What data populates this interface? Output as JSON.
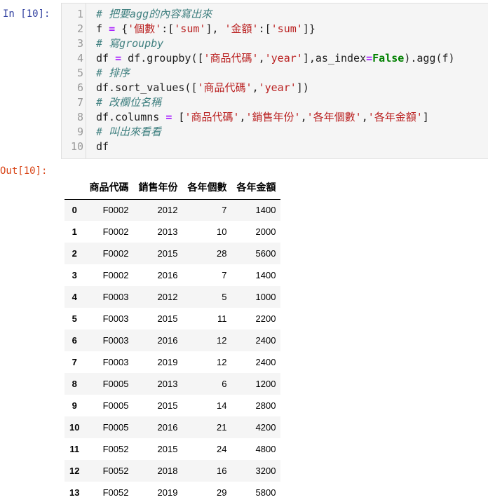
{
  "prompts": {
    "input": "In [10]:",
    "output": "Out[10]:"
  },
  "code_lines": [
    {
      "n": "1",
      "parts": [
        {
          "t": "# 把要agg的內容寫出來",
          "c": "cm"
        }
      ]
    },
    {
      "n": "2",
      "parts": [
        {
          "t": "f ",
          "c": ""
        },
        {
          "t": "=",
          "c": "op"
        },
        {
          "t": " {",
          "c": ""
        },
        {
          "t": "'個數'",
          "c": "str"
        },
        {
          "t": ":[",
          "c": ""
        },
        {
          "t": "'sum'",
          "c": "str"
        },
        {
          "t": "], ",
          "c": ""
        },
        {
          "t": "'金額'",
          "c": "str"
        },
        {
          "t": ":[",
          "c": ""
        },
        {
          "t": "'sum'",
          "c": "str"
        },
        {
          "t": "]}",
          "c": ""
        }
      ]
    },
    {
      "n": "3",
      "parts": [
        {
          "t": "# 寫groupby",
          "c": "cm"
        }
      ]
    },
    {
      "n": "4",
      "parts": [
        {
          "t": "df ",
          "c": ""
        },
        {
          "t": "=",
          "c": "op"
        },
        {
          "t": " df.groupby([",
          "c": ""
        },
        {
          "t": "'商品代碼'",
          "c": "str"
        },
        {
          "t": ",",
          "c": ""
        },
        {
          "t": "'year'",
          "c": "str"
        },
        {
          "t": "],as_index",
          "c": ""
        },
        {
          "t": "=",
          "c": "op"
        },
        {
          "t": "False",
          "c": "kw"
        },
        {
          "t": ").agg(f)",
          "c": ""
        }
      ]
    },
    {
      "n": "5",
      "parts": [
        {
          "t": "# 排序",
          "c": "cm"
        }
      ]
    },
    {
      "n": "6",
      "parts": [
        {
          "t": "df.sort_values([",
          "c": ""
        },
        {
          "t": "'商品代碼'",
          "c": "str"
        },
        {
          "t": ",",
          "c": ""
        },
        {
          "t": "'year'",
          "c": "str"
        },
        {
          "t": "])",
          "c": ""
        }
      ]
    },
    {
      "n": "7",
      "parts": [
        {
          "t": "# 改欄位名稱",
          "c": "cm"
        }
      ]
    },
    {
      "n": "8",
      "parts": [
        {
          "t": "df.columns ",
          "c": ""
        },
        {
          "t": "=",
          "c": "op"
        },
        {
          "t": " [",
          "c": ""
        },
        {
          "t": "'商品代碼'",
          "c": "str"
        },
        {
          "t": ",",
          "c": ""
        },
        {
          "t": "'銷售年份'",
          "c": "str"
        },
        {
          "t": ",",
          "c": ""
        },
        {
          "t": "'各年個數'",
          "c": "str"
        },
        {
          "t": ",",
          "c": ""
        },
        {
          "t": "'各年金額'",
          "c": "str"
        },
        {
          "t": "]",
          "c": ""
        }
      ]
    },
    {
      "n": "9",
      "parts": [
        {
          "t": "# 叫出來看看",
          "c": "cm"
        }
      ]
    },
    {
      "n": "10",
      "parts": [
        {
          "t": "df",
          "c": ""
        }
      ]
    }
  ],
  "table": {
    "columns": [
      "",
      "商品代碼",
      "銷售年份",
      "各年個數",
      "各年金額"
    ],
    "rows": [
      [
        "0",
        "F0002",
        "2012",
        "7",
        "1400"
      ],
      [
        "1",
        "F0002",
        "2013",
        "10",
        "2000"
      ],
      [
        "2",
        "F0002",
        "2015",
        "28",
        "5600"
      ],
      [
        "3",
        "F0002",
        "2016",
        "7",
        "1400"
      ],
      [
        "4",
        "F0003",
        "2012",
        "5",
        "1000"
      ],
      [
        "5",
        "F0003",
        "2015",
        "11",
        "2200"
      ],
      [
        "6",
        "F0003",
        "2016",
        "12",
        "2400"
      ],
      [
        "7",
        "F0003",
        "2019",
        "12",
        "2400"
      ],
      [
        "8",
        "F0005",
        "2013",
        "6",
        "1200"
      ],
      [
        "9",
        "F0005",
        "2015",
        "14",
        "2800"
      ],
      [
        "10",
        "F0005",
        "2016",
        "21",
        "4200"
      ],
      [
        "11",
        "F0052",
        "2015",
        "24",
        "4800"
      ],
      [
        "12",
        "F0052",
        "2018",
        "16",
        "3200"
      ],
      [
        "13",
        "F0052",
        "2019",
        "29",
        "5800"
      ]
    ]
  },
  "colors": {
    "in_prompt": "#303f9f",
    "out_prompt": "#d84315",
    "comment": "#408080",
    "string": "#ba2121",
    "operator": "#aa22ff",
    "keyword": "#008000"
  }
}
